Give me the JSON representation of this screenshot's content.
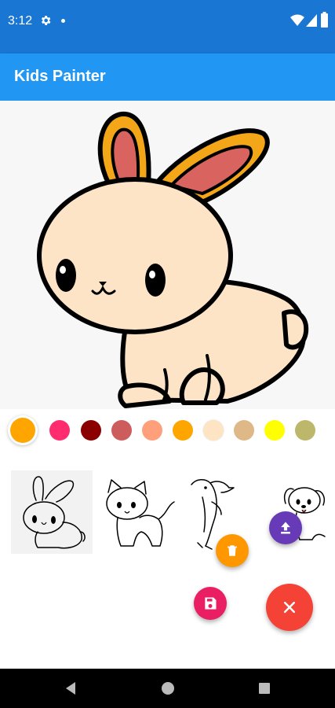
{
  "status": {
    "time": "3:12"
  },
  "app": {
    "title": "Kids Painter"
  },
  "colors": {
    "status_bar": "#1976d2",
    "app_bar": "#2196f3",
    "fab_upload": "#673ab7",
    "fab_delete": "#ff9800",
    "fab_save": "#e91e63",
    "fab_close": "#f44336"
  },
  "palette": {
    "selected_index": 0,
    "swatches": [
      "#ffa500",
      "#ff2d6f",
      "#8b0000",
      "#cd5c5c",
      "#ffa07a",
      "#ffa500",
      "#ffe4c4",
      "#deb887",
      "#ffff00",
      "#bdb76b"
    ]
  },
  "pictures": [
    "bunny",
    "kitten",
    "dolphin",
    "puppy"
  ],
  "fabs": [
    "upload",
    "delete",
    "save",
    "close"
  ]
}
